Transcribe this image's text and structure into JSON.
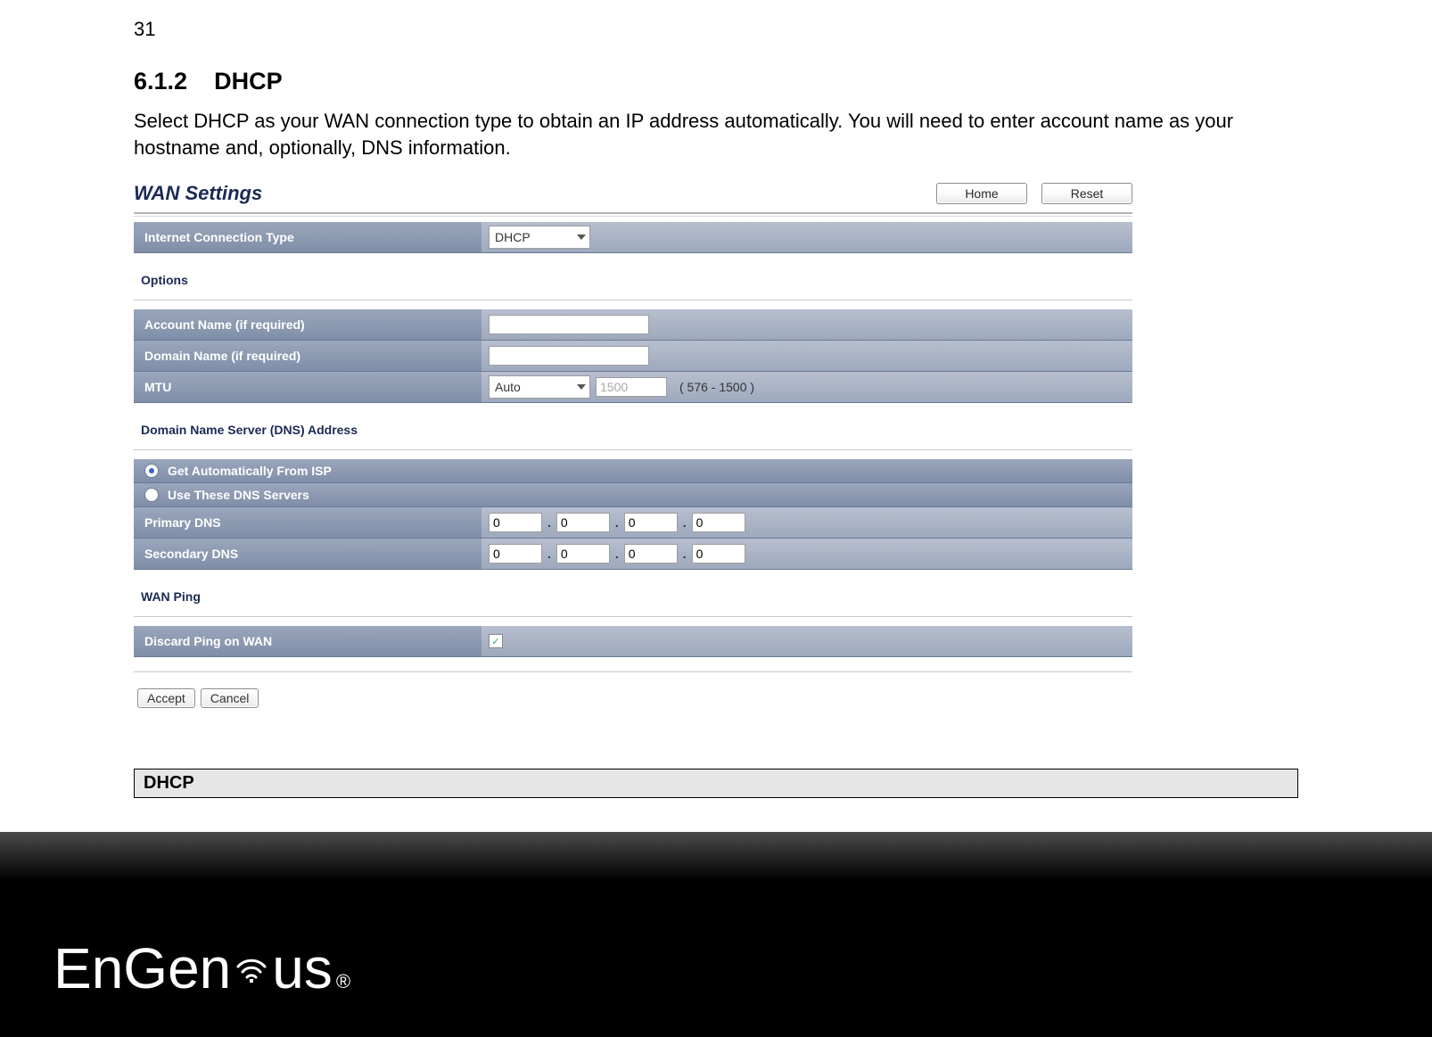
{
  "page_number": "31",
  "section_number": "6.1.2",
  "section_title": "DHCP",
  "section_text": "Select DHCP as your WAN connection type to obtain an IP address automatically. You will need to enter account name as your hostname and, optionally, DNS information.",
  "router": {
    "title": "WAN Settings",
    "home_btn": "Home",
    "reset_btn": "Reset",
    "conn_type_label": "Internet Connection Type",
    "conn_type_value": "DHCP",
    "options_heading": "Options",
    "account_label": "Account Name (if required)",
    "account_value": "",
    "domain_label": "Domain Name (if required)",
    "domain_value": "",
    "mtu_label": "MTU",
    "mtu_mode": "Auto",
    "mtu_value": "1500",
    "mtu_range": "( 576 - 1500 )",
    "dns_heading": "Domain Name Server (DNS) Address",
    "dns_auto_label": "Get Automatically From ISP",
    "dns_manual_label": "Use These DNS Servers",
    "primary_dns_label": "Primary DNS",
    "secondary_dns_label": "Secondary DNS",
    "primary_dns": [
      "0",
      "0",
      "0",
      "0"
    ],
    "secondary_dns": [
      "0",
      "0",
      "0",
      "0"
    ],
    "wan_ping_heading": "WAN Ping",
    "discard_ping_label": "Discard Ping on WAN",
    "accept_btn": "Accept",
    "cancel_btn": "Cancel"
  },
  "table_header": "DHCP",
  "brand": "EnGenius"
}
